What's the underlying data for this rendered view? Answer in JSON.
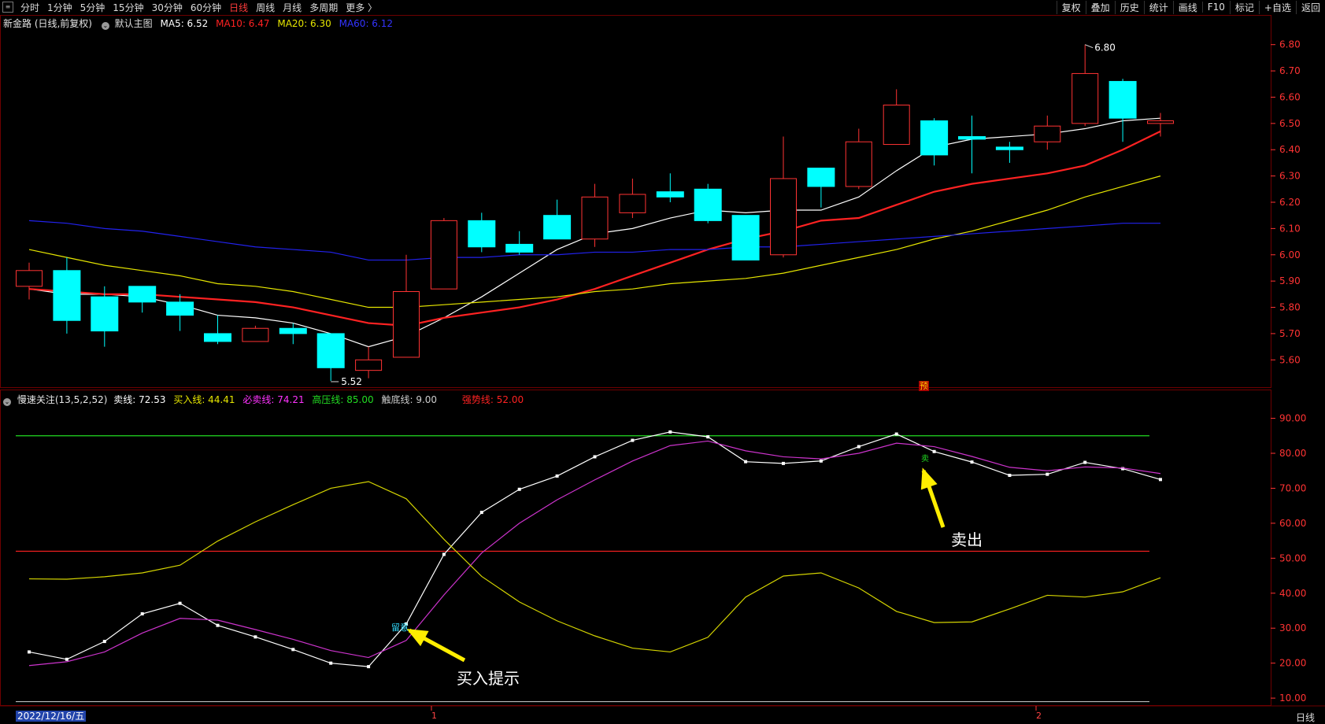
{
  "toolbar": {
    "app_icon": "menu-icon",
    "periods": [
      "分时",
      "1分钟",
      "5分钟",
      "15分钟",
      "30分钟",
      "60分钟",
      "日线",
      "周线",
      "月线",
      "多周期",
      "更多 〉"
    ],
    "active_period": "日线",
    "right_items": [
      "复权",
      "叠加",
      "历史",
      "统计",
      "画线",
      "F10",
      "标记",
      "+自选",
      "返回"
    ]
  },
  "colors": {
    "up": "#ff3333",
    "down": "#00ffff",
    "ma5": "#ffffff",
    "ma10": "#ff2222",
    "ma20": "#e6e600",
    "ma60": "#2222ee",
    "grid": "#6e0000"
  },
  "main_legend": {
    "stock": "新金路 (日线,前复权)",
    "indicator_name": "默认主图",
    "ma5": "MA5: 6.52",
    "ma10": "MA10: 6.47",
    "ma20": "MA20: 6.30",
    "ma60": "MA60: 6.12"
  },
  "sub_legend": {
    "name": "慢速关注(13,5,2,52)",
    "sell_line": "卖线: 72.53",
    "buy_in_line": "买入线: 44.41",
    "must_sell_line": "必卖线: 74.21",
    "high_pressure_line": "高压线: 85.00",
    "bottom_line": "触底线: 9.00",
    "strong_line": "强势线: 52.00"
  },
  "bottom_bar": {
    "date": "2022/12/16/五",
    "month_ticks": [
      "1",
      "2"
    ],
    "period_label": "日线"
  },
  "markers": {
    "yu": "预",
    "zhuyi": "留意",
    "sell_flag": "卖"
  },
  "annotations": {
    "buy_hint": "买入提示",
    "sell": "卖出"
  },
  "chart_data": [
    {
      "type": "candlestick",
      "title": "新金路 (日线,前复权)",
      "ylim": [
        5.52,
        6.88
      ],
      "y_ticks": [
        5.6,
        5.7,
        5.8,
        5.9,
        6.0,
        6.1,
        6.2,
        6.3,
        6.4,
        6.5,
        6.6,
        6.7,
        6.8
      ],
      "candles": [
        {
          "o": 5.88,
          "h": 5.97,
          "l": 5.83,
          "c": 5.94
        },
        {
          "o": 5.94,
          "h": 5.99,
          "l": 5.7,
          "c": 5.75
        },
        {
          "o": 5.84,
          "h": 5.88,
          "l": 5.65,
          "c": 5.71
        },
        {
          "o": 5.88,
          "h": 5.88,
          "l": 5.78,
          "c": 5.82
        },
        {
          "o": 5.82,
          "h": 5.85,
          "l": 5.71,
          "c": 5.77
        },
        {
          "o": 5.7,
          "h": 5.77,
          "l": 5.66,
          "c": 5.67
        },
        {
          "o": 5.67,
          "h": 5.73,
          "l": 5.67,
          "c": 5.72
        },
        {
          "o": 5.72,
          "h": 5.74,
          "l": 5.66,
          "c": 5.7
        },
        {
          "o": 5.7,
          "h": 5.69,
          "l": 5.52,
          "c": 5.57
        },
        {
          "o": 5.56,
          "h": 5.65,
          "l": 5.53,
          "c": 5.6
        },
        {
          "o": 5.61,
          "h": 6.0,
          "l": 5.61,
          "c": 5.86
        },
        {
          "o": 5.87,
          "h": 6.14,
          "l": 5.87,
          "c": 6.13
        },
        {
          "o": 6.13,
          "h": 6.16,
          "l": 6.01,
          "c": 6.03
        },
        {
          "o": 6.04,
          "h": 6.09,
          "l": 6.0,
          "c": 6.01
        },
        {
          "o": 6.15,
          "h": 6.21,
          "l": 6.06,
          "c": 6.06
        },
        {
          "o": 6.06,
          "h": 6.27,
          "l": 6.03,
          "c": 6.22
        },
        {
          "o": 6.16,
          "h": 6.29,
          "l": 6.14,
          "c": 6.23
        },
        {
          "o": 6.24,
          "h": 6.31,
          "l": 6.2,
          "c": 6.22
        },
        {
          "o": 6.25,
          "h": 6.27,
          "l": 6.12,
          "c": 6.13
        },
        {
          "o": 6.15,
          "h": 6.15,
          "l": 5.98,
          "c": 5.98
        },
        {
          "o": 6.0,
          "h": 6.45,
          "l": 5.99,
          "c": 6.29
        },
        {
          "o": 6.33,
          "h": 6.33,
          "l": 6.18,
          "c": 6.26
        },
        {
          "o": 6.26,
          "h": 6.48,
          "l": 6.25,
          "c": 6.43
        },
        {
          "o": 6.42,
          "h": 6.63,
          "l": 6.42,
          "c": 6.57
        },
        {
          "o": 6.51,
          "h": 6.52,
          "l": 6.34,
          "c": 6.38
        },
        {
          "o": 6.45,
          "h": 6.53,
          "l": 6.31,
          "c": 6.44
        },
        {
          "o": 6.41,
          "h": 6.43,
          "l": 6.35,
          "c": 6.4
        },
        {
          "o": 6.43,
          "h": 6.53,
          "l": 6.4,
          "c": 6.49
        },
        {
          "o": 6.5,
          "h": 6.8,
          "l": 6.49,
          "c": 6.69
        },
        {
          "o": 6.66,
          "h": 6.67,
          "l": 6.43,
          "c": 6.52
        },
        {
          "o": 6.5,
          "h": 6.54,
          "l": 6.45,
          "c": 6.51
        }
      ],
      "series": [
        {
          "name": "MA5",
          "values": [
            5.87,
            5.85,
            5.85,
            5.84,
            5.81,
            5.77,
            5.76,
            5.74,
            5.7,
            5.65,
            5.69,
            5.76,
            5.84,
            5.93,
            6.02,
            6.08,
            6.1,
            6.14,
            6.17,
            6.16,
            6.17,
            6.17,
            6.22,
            6.32,
            6.41,
            6.44,
            6.45,
            6.46,
            6.48,
            6.51,
            6.52
          ]
        },
        {
          "name": "MA10",
          "values": [
            5.87,
            5.86,
            5.85,
            5.85,
            5.84,
            5.83,
            5.82,
            5.8,
            5.77,
            5.74,
            5.73,
            5.76,
            5.78,
            5.8,
            5.83,
            5.87,
            5.92,
            5.97,
            6.02,
            6.06,
            6.09,
            6.13,
            6.14,
            6.19,
            6.24,
            6.27,
            6.29,
            6.31,
            6.34,
            6.4,
            6.47
          ]
        },
        {
          "name": "MA20",
          "values": [
            6.02,
            5.99,
            5.96,
            5.94,
            5.92,
            5.89,
            5.88,
            5.86,
            5.83,
            5.8,
            5.8,
            5.81,
            5.82,
            5.83,
            5.84,
            5.86,
            5.87,
            5.89,
            5.9,
            5.91,
            5.93,
            5.96,
            5.99,
            6.02,
            6.06,
            6.09,
            6.13,
            6.17,
            6.22,
            6.26,
            6.3
          ]
        },
        {
          "name": "MA60",
          "values": [
            6.13,
            6.12,
            6.1,
            6.09,
            6.07,
            6.05,
            6.03,
            6.02,
            6.01,
            5.98,
            5.98,
            5.99,
            5.99,
            6.0,
            6.0,
            6.01,
            6.01,
            6.02,
            6.02,
            6.03,
            6.03,
            6.04,
            6.05,
            6.06,
            6.07,
            6.08,
            6.09,
            6.1,
            6.11,
            6.12,
            6.12
          ]
        }
      ],
      "labels": {
        "max": "6.80",
        "min": "5.52"
      }
    },
    {
      "type": "line",
      "title": "慢速关注(13,5,2,52)",
      "ylim": [
        8,
        98
      ],
      "y_ticks": [
        10.0,
        20.0,
        30.0,
        40.0,
        50.0,
        60.0,
        70.0,
        80.0,
        90.0
      ],
      "hlines": [
        {
          "name": "高压线",
          "value": 85.0,
          "color": "#22dd22"
        },
        {
          "name": "强势线",
          "value": 52.0,
          "color": "#ff2222"
        },
        {
          "name": "触底线",
          "value": 9.0,
          "color": "#bbbbbb"
        }
      ],
      "series": [
        {
          "name": "卖线",
          "color": "#ffffff",
          "values": [
            23.2,
            21.1,
            26.2,
            34.1,
            37.1,
            30.8,
            27.5,
            23.9,
            20.0,
            19.0,
            31.2,
            51.1,
            63.1,
            69.7,
            73.5,
            79.0,
            83.7,
            86.1,
            84.7,
            77.6,
            77.1,
            77.8,
            81.9,
            85.5,
            80.5,
            77.5,
            73.7,
            74.0,
            77.4,
            75.6,
            72.5
          ]
        },
        {
          "name": "必卖线",
          "color": "#cc33cc",
          "values": [
            19.3,
            20.4,
            23.2,
            28.6,
            32.8,
            32.3,
            29.6,
            26.8,
            23.6,
            21.6,
            26.5,
            39.5,
            51.5,
            60.0,
            66.7,
            72.4,
            77.8,
            82.2,
            83.5,
            80.7,
            79.0,
            78.4,
            80.0,
            82.9,
            81.9,
            79.1,
            76.0,
            75.0,
            76.1,
            75.8,
            74.2
          ]
        },
        {
          "name": "买入线",
          "color": "#d4d400",
          "values": [
            44.1,
            44.0,
            44.7,
            45.8,
            48.0,
            54.9,
            60.4,
            65.3,
            70.0,
            71.9,
            67.0,
            55.4,
            44.8,
            37.5,
            32.1,
            27.8,
            24.3,
            23.2,
            27.4,
            38.9,
            44.9,
            45.8,
            41.5,
            34.8,
            31.6,
            31.8,
            35.5,
            39.4,
            38.9,
            40.4,
            44.4
          ]
        }
      ]
    }
  ]
}
